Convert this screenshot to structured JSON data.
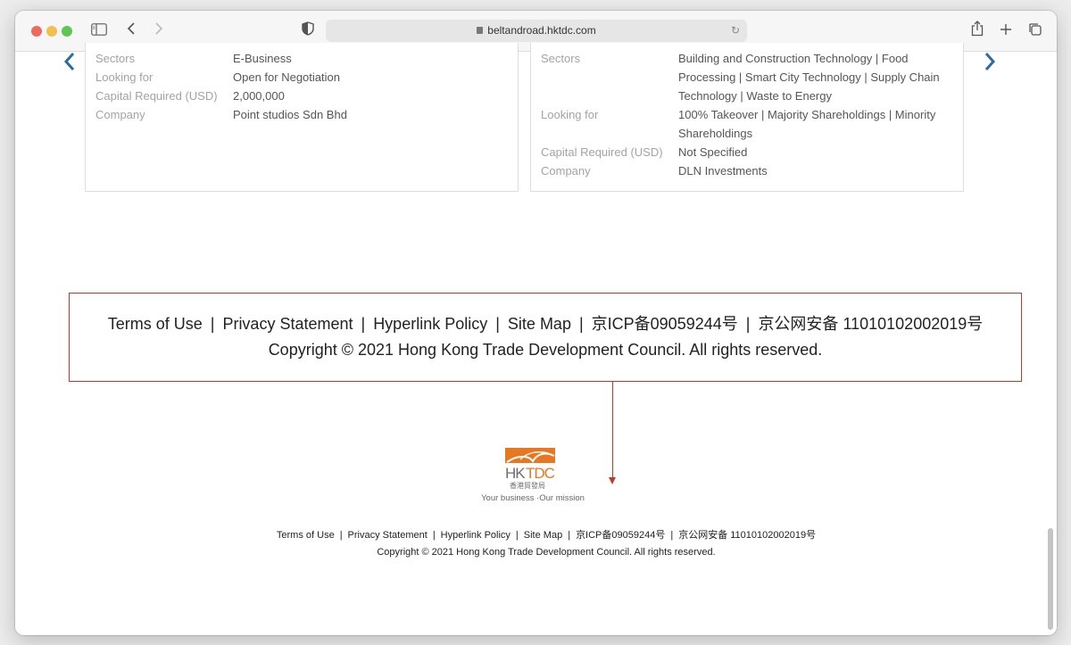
{
  "browser": {
    "url": "beltandroad.hktdc.com",
    "icons": {
      "sidebar": "sidebar-icon",
      "back": "chevron-left-icon",
      "forward": "chevron-right-icon",
      "privacy": "shield-icon",
      "lock": "lock-icon",
      "reload": "reload-icon",
      "share": "share-icon",
      "new_tab": "plus-icon",
      "tabs": "tabs-overview-icon"
    }
  },
  "cards": [
    {
      "rows": [
        {
          "label": "Sectors",
          "value": "E-Business"
        },
        {
          "label": "Looking for",
          "value": "Open for Negotiation"
        },
        {
          "label": "Capital Required (USD)",
          "value": "2,000,000"
        },
        {
          "label": "Company",
          "value": "Point studios Sdn Bhd"
        }
      ]
    },
    {
      "rows": [
        {
          "label": "Sectors",
          "value_lines": [
            "Building and Construction Technology | Food",
            "Processing | Smart City Technology | Supply Chain",
            "Technology | Waste to Energy"
          ]
        },
        {
          "label": "Looking for",
          "value_lines": [
            "100% Takeover | Majority Shareholdings | Minority",
            "Shareholdings"
          ]
        },
        {
          "label": "Capital Required (USD)",
          "value": "Not Specified"
        },
        {
          "label": "Company",
          "value": "DLN Investments"
        }
      ]
    }
  ],
  "carousel": {
    "prev_icon": "chevron-left-icon",
    "next_icon": "chevron-right-icon",
    "prev_glyph": "‹",
    "next_glyph": "›"
  },
  "footer": {
    "links": [
      "Terms of Use",
      "Privacy Statement",
      "Hyperlink Policy",
      "Site Map",
      "京ICP备09059244号",
      "京公网安备 11010102002019号"
    ],
    "separator": "|",
    "copyright": "Copyright © 2021  Hong Kong Trade Development Council. All rights reserved.",
    "logo_text": "HKTDC",
    "logo_chinese": "香港貿發局",
    "tagline": "Your business ·Our mission"
  },
  "colors": {
    "callout_border": "#c8371f",
    "carousel_arrow": "#2f6aa6",
    "logo_orange": "#e87722",
    "logo_grey": "#6d6e71"
  }
}
